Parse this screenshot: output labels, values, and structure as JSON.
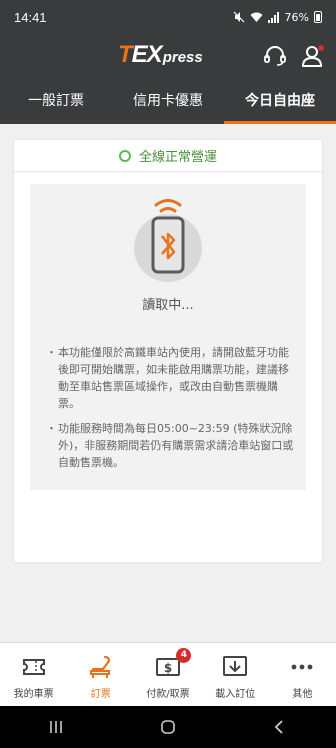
{
  "status_bar": {
    "time": "14:41",
    "battery": "76%"
  },
  "header": {
    "logo": {
      "t": "T",
      "ex": "EX",
      "press": "press"
    },
    "support_icon": "headset-icon",
    "account_icon": "user-icon"
  },
  "tabs": [
    {
      "label": "一般訂票",
      "active": false
    },
    {
      "label": "信用卡優惠",
      "active": false
    },
    {
      "label": "今日自由座",
      "active": true
    }
  ],
  "service_status": {
    "label": "全線正常營運",
    "color": "#5cb85c"
  },
  "reader": {
    "icon": "bluetooth-phone-icon",
    "status": "讀取中...",
    "notes": [
      "本功能僅限於高鐵車站內使用，請開啟藍牙功能後即可開始購票，如未能啟用購票功能，建議移動至車站售票區域操作，或改由自動售票機購票。",
      "功能服務時間為每日05:00~23:59 (特殊狀況除外)，非服務期間若仍有購票需求請洽車站窗口或自動售票機。"
    ]
  },
  "bottom_nav": [
    {
      "label": "我的車票",
      "icon": "ticket-icon",
      "active": false
    },
    {
      "label": "訂票",
      "icon": "seat-icon",
      "active": true
    },
    {
      "label": "付款/取票",
      "icon": "payment-icon",
      "active": false,
      "badge": "4"
    },
    {
      "label": "載入訂位",
      "icon": "download-icon",
      "active": false
    },
    {
      "label": "其他",
      "icon": "more-icon",
      "active": false
    }
  ],
  "colors": {
    "accent": "#e8731c",
    "header_bg": "#3a3b3d",
    "status_green": "#5cb85c",
    "badge_red": "#d62c2c"
  }
}
